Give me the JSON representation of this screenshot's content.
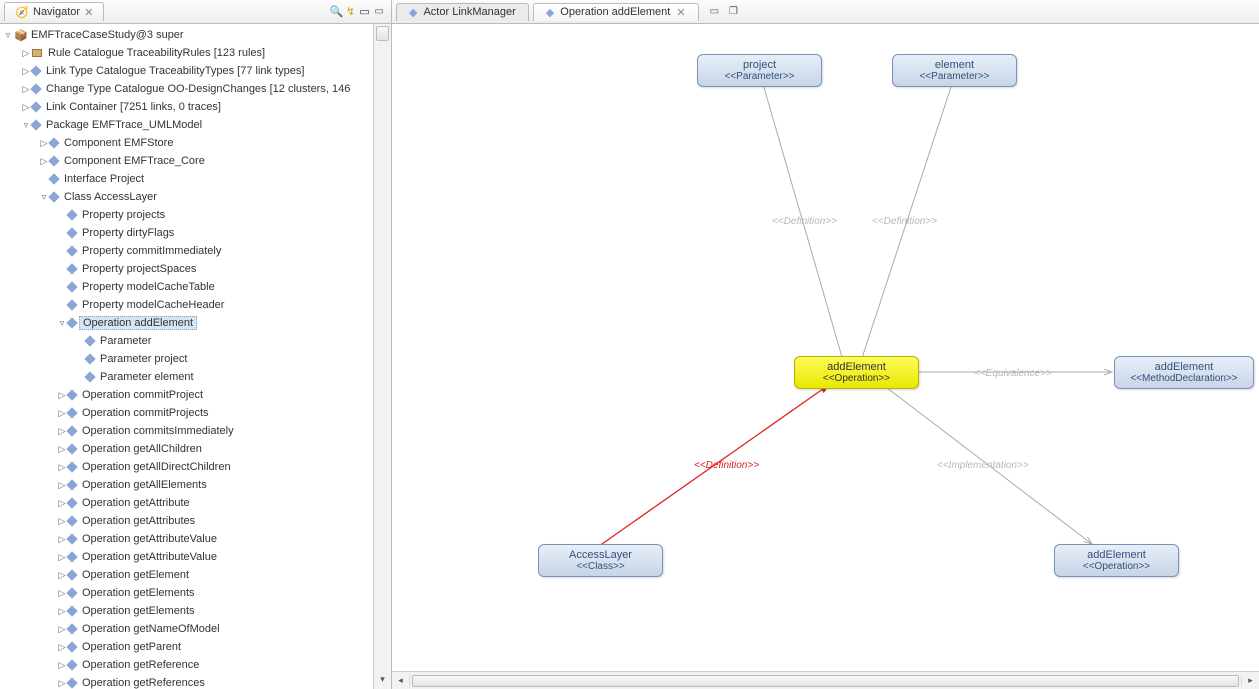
{
  "navigator": {
    "title": "Navigator",
    "root": "EMFTraceCaseStudy@3 super",
    "toolbar": {
      "search": "🔍",
      "link": "↯",
      "collapse": "▭",
      "min": "▭"
    },
    "items": [
      {
        "indent": 1,
        "toggle": "▷",
        "icon": "pkg",
        "label": "Rule Catalogue TraceabilityRules [123 rules]"
      },
      {
        "indent": 1,
        "toggle": "▷",
        "icon": "diamond",
        "label": "Link Type Catalogue TraceabilityTypes [77 link types]"
      },
      {
        "indent": 1,
        "toggle": "▷",
        "icon": "diamond",
        "label": "Change Type Catalogue OO-DesignChanges [12 clusters, 146"
      },
      {
        "indent": 1,
        "toggle": "▷",
        "icon": "diamond",
        "label": "Link Container [7251 links, 0 traces]"
      },
      {
        "indent": 1,
        "toggle": "▿",
        "icon": "diamond",
        "label": "Package EMFTrace_UMLModel"
      },
      {
        "indent": 2,
        "toggle": "▷",
        "icon": "diamond",
        "label": "Component EMFStore"
      },
      {
        "indent": 2,
        "toggle": "▷",
        "icon": "diamond",
        "label": "Component EMFTrace_Core"
      },
      {
        "indent": 2,
        "toggle": "",
        "icon": "diamond",
        "label": "Interface Project"
      },
      {
        "indent": 2,
        "toggle": "▿",
        "icon": "diamond",
        "label": "Class AccessLayer"
      },
      {
        "indent": 3,
        "toggle": "",
        "icon": "diamond",
        "label": "Property projects"
      },
      {
        "indent": 3,
        "toggle": "",
        "icon": "diamond",
        "label": "Property dirtyFlags"
      },
      {
        "indent": 3,
        "toggle": "",
        "icon": "diamond",
        "label": "Property commitImmediately"
      },
      {
        "indent": 3,
        "toggle": "",
        "icon": "diamond",
        "label": "Property projectSpaces"
      },
      {
        "indent": 3,
        "toggle": "",
        "icon": "diamond",
        "label": "Property modelCacheTable"
      },
      {
        "indent": 3,
        "toggle": "",
        "icon": "diamond",
        "label": "Property modelCacheHeader"
      },
      {
        "indent": 3,
        "toggle": "▿",
        "icon": "diamond",
        "label": "Operation addElement",
        "selected": true
      },
      {
        "indent": 4,
        "toggle": "",
        "icon": "diamond",
        "label": "Parameter"
      },
      {
        "indent": 4,
        "toggle": "",
        "icon": "diamond",
        "label": "Parameter project"
      },
      {
        "indent": 4,
        "toggle": "",
        "icon": "diamond",
        "label": "Parameter element"
      },
      {
        "indent": 3,
        "toggle": "▷",
        "icon": "diamond",
        "label": "Operation commitProject"
      },
      {
        "indent": 3,
        "toggle": "▷",
        "icon": "diamond",
        "label": "Operation commitProjects"
      },
      {
        "indent": 3,
        "toggle": "▷",
        "icon": "diamond",
        "label": "Operation commitsImmediately"
      },
      {
        "indent": 3,
        "toggle": "▷",
        "icon": "diamond",
        "label": "Operation getAllChildren"
      },
      {
        "indent": 3,
        "toggle": "▷",
        "icon": "diamond",
        "label": "Operation getAllDirectChildren"
      },
      {
        "indent": 3,
        "toggle": "▷",
        "icon": "diamond",
        "label": "Operation getAllElements"
      },
      {
        "indent": 3,
        "toggle": "▷",
        "icon": "diamond",
        "label": "Operation getAttribute"
      },
      {
        "indent": 3,
        "toggle": "▷",
        "icon": "diamond",
        "label": "Operation getAttributes"
      },
      {
        "indent": 3,
        "toggle": "▷",
        "icon": "diamond",
        "label": "Operation getAttributeValue"
      },
      {
        "indent": 3,
        "toggle": "▷",
        "icon": "diamond",
        "label": "Operation getAttributeValue"
      },
      {
        "indent": 3,
        "toggle": "▷",
        "icon": "diamond",
        "label": "Operation getElement"
      },
      {
        "indent": 3,
        "toggle": "▷",
        "icon": "diamond",
        "label": "Operation getElements"
      },
      {
        "indent": 3,
        "toggle": "▷",
        "icon": "diamond",
        "label": "Operation getElements"
      },
      {
        "indent": 3,
        "toggle": "▷",
        "icon": "diamond",
        "label": "Operation getNameOfModel"
      },
      {
        "indent": 3,
        "toggle": "▷",
        "icon": "diamond",
        "label": "Operation getParent"
      },
      {
        "indent": 3,
        "toggle": "▷",
        "icon": "diamond",
        "label": "Operation getReference"
      },
      {
        "indent": 3,
        "toggle": "▷",
        "icon": "diamond",
        "label": "Operation getReferences"
      }
    ]
  },
  "editor": {
    "tabs": [
      {
        "icon": "◆",
        "label": "Actor LinkManager",
        "active": false
      },
      {
        "icon": "◆",
        "label": "Operation addElement",
        "active": true
      }
    ],
    "nodes": {
      "project": {
        "title": "project",
        "stereo": "<<Parameter>>"
      },
      "element": {
        "title": "element",
        "stereo": "<<Parameter>>"
      },
      "center": {
        "title": "addElement",
        "stereo": "<<Operation>>"
      },
      "right": {
        "title": "addElement",
        "stereo": "<<MethodDeclaration>>"
      },
      "bl": {
        "title": "AccessLayer",
        "stereo": "<<Class>>"
      },
      "br": {
        "title": "addElement",
        "stereo": "<<Operation>>"
      }
    },
    "edgeLabels": {
      "def1": "<<Definition>>",
      "def2": "<<Definition>>",
      "equiv": "<<Equivalence>>",
      "defRed": "<<Definition>>",
      "impl": "<<Implementation>>"
    }
  }
}
